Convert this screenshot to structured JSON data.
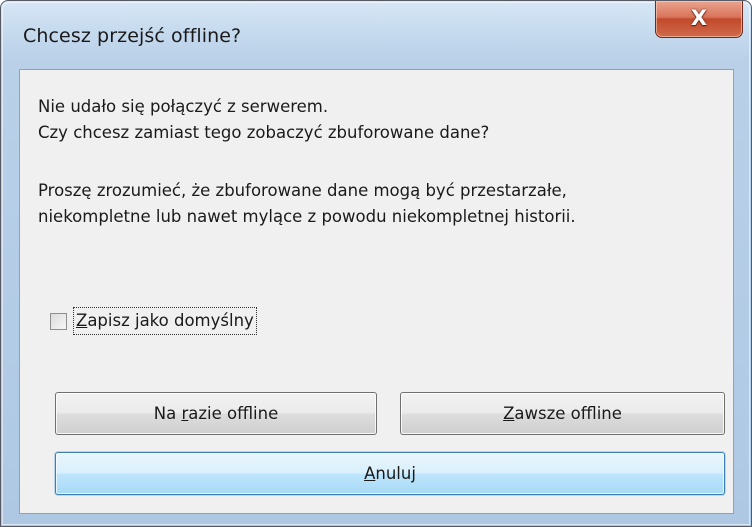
{
  "window": {
    "title": "Chcesz przejść offline?",
    "close_symbol": "X"
  },
  "message": {
    "line1": "Nie udało się połączyć z serwerem.",
    "line2": "Czy chcesz zamiast tego zobaczyć zbuforowane dane?",
    "line3": "Proszę zrozumieć, że zbuforowane dane mogą być przestarzałe,",
    "line4": "niekompletne lub nawet mylące z powodu niekompletnej historii."
  },
  "checkbox": {
    "label_mnemonic": "Z",
    "label_rest": "apisz jako domyślny",
    "checked": false
  },
  "buttons": {
    "now_pre": "Na ",
    "now_mnemonic": "r",
    "now_rest": "azie offline",
    "always_mnemonic": "Z",
    "always_rest": "awsze offline",
    "cancel_mnemonic": "A",
    "cancel_rest": "nuluj"
  },
  "icons": {
    "close": "close-icon"
  },
  "colors": {
    "close_button": "#c24a2c",
    "default_button_border": "#3c7fb1",
    "client_background": "#f0f0f0"
  }
}
